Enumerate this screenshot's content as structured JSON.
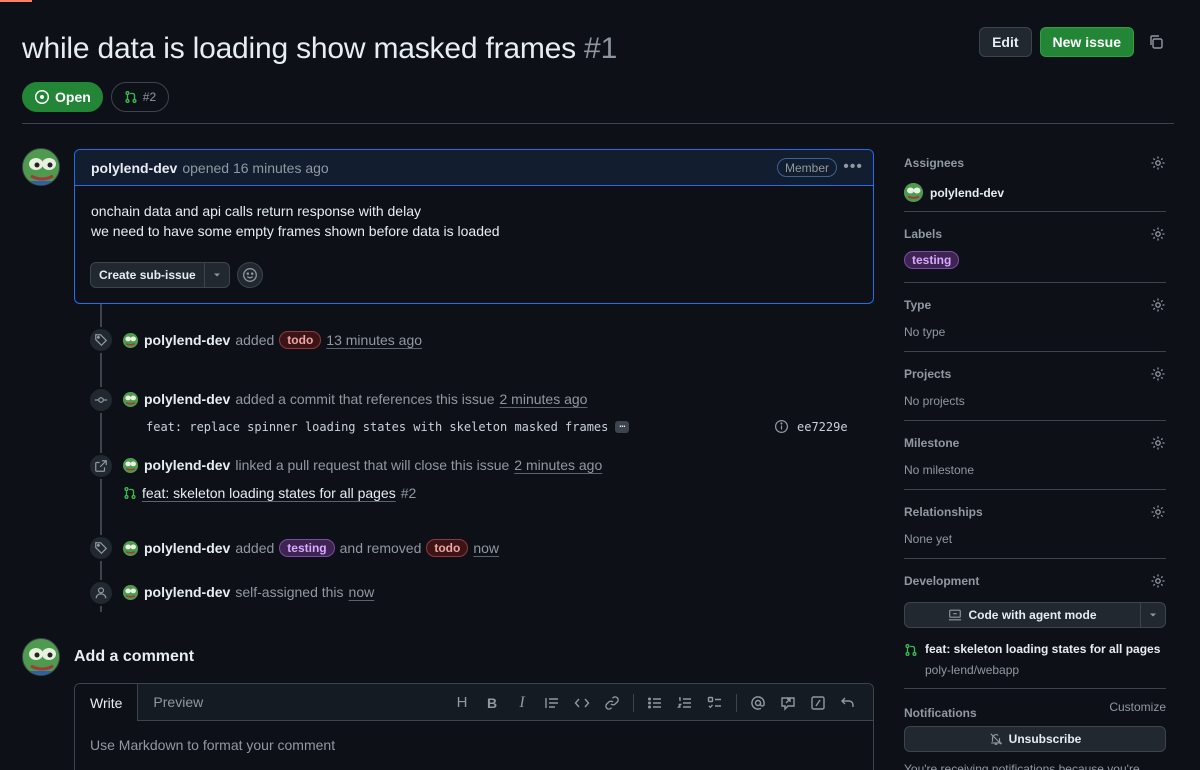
{
  "header": {
    "title": "while data is loading show masked frames",
    "issue_number": "#1",
    "edit_label": "Edit",
    "new_issue_label": "New issue"
  },
  "status": {
    "state": "Open",
    "linked_pr": "#2"
  },
  "comment": {
    "author": "polylend-dev",
    "opened_text": "opened 16 minutes ago",
    "role_badge": "Member",
    "body_lines": [
      "onchain data and api calls return response with delay",
      "we need to have some empty frames shown before data is loaded"
    ],
    "sub_issue_label": "Create sub-issue"
  },
  "timeline": {
    "event1": {
      "author": "polylend-dev",
      "action": "added",
      "label": "todo",
      "time": "13 minutes ago"
    },
    "event2": {
      "author": "polylend-dev",
      "action": "added a commit that references this issue",
      "time": "2 minutes ago",
      "commit_message": "feat: replace spinner loading states with skeleton masked frames",
      "ellipsis": "…",
      "sha": "ee7229e"
    },
    "event3": {
      "author": "polylend-dev",
      "action": "linked a pull request that will close this issue",
      "time": "2 minutes ago",
      "pr_title": "feat: skeleton loading states for all pages",
      "pr_number": "#2"
    },
    "event4": {
      "author": "polylend-dev",
      "action": "added",
      "label_added": "testing",
      "middle": "and removed",
      "label_removed": "todo",
      "time": "now"
    },
    "event5": {
      "author": "polylend-dev",
      "action": "self-assigned this",
      "time": "now"
    }
  },
  "add_comment": {
    "title": "Add a comment",
    "tab_write": "Write",
    "tab_preview": "Preview",
    "placeholder": "Use Markdown to format your comment",
    "toolbar": {
      "heading": "H",
      "bold": "B",
      "italic": "I"
    }
  },
  "sidebar": {
    "assignees": {
      "title": "Assignees",
      "value": "polylend-dev"
    },
    "labels": {
      "title": "Labels",
      "value": "testing"
    },
    "type": {
      "title": "Type",
      "value": "No type"
    },
    "projects": {
      "title": "Projects",
      "value": "No projects"
    },
    "milestone": {
      "title": "Milestone",
      "value": "No milestone"
    },
    "relationships": {
      "title": "Relationships",
      "value": "None yet"
    },
    "development": {
      "title": "Development",
      "agent_button": "Code with agent mode",
      "pr_title": "feat: skeleton loading states for all pages",
      "repo": "poly-lend/webapp"
    },
    "notifications": {
      "title": "Notifications",
      "customize": "Customize",
      "unsubscribe": "Unsubscribe",
      "text": "You're receiving notifications because you're"
    }
  },
  "colors": {
    "background": "#0d1117",
    "open_green": "#238636",
    "accent_blue": "#1f6feb",
    "label_todo": "#8e3a3a",
    "label_testing": "#7d4aa6"
  }
}
